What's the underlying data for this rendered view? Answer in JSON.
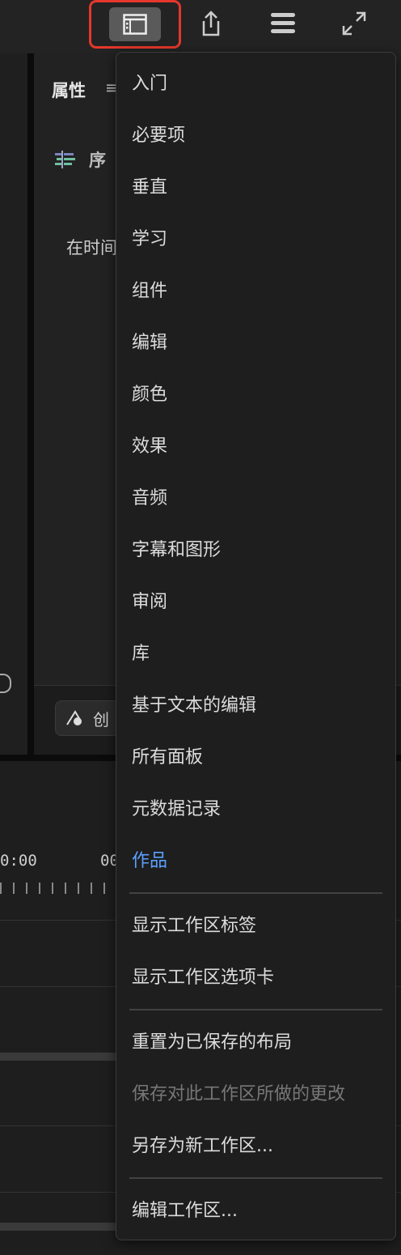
{
  "topbar": {
    "workspaces_icon": "workspace-panel-icon",
    "share_icon": "share-export-icon",
    "menu_icon": "stack-lines-icon",
    "fullscreen_icon": "expand-arrows-icon"
  },
  "properties": {
    "title": "属性",
    "seq_label": "序",
    "timeline_hint": "在时间",
    "create_label": "创"
  },
  "timeline": {
    "tc_left": "0:00",
    "tc_right": "00"
  },
  "menu": {
    "workspaces": [
      {
        "label": "入门"
      },
      {
        "label": "必要项"
      },
      {
        "label": "垂直"
      },
      {
        "label": "学习"
      },
      {
        "label": "组件"
      },
      {
        "label": "编辑"
      },
      {
        "label": "颜色"
      },
      {
        "label": "效果"
      },
      {
        "label": "音频"
      },
      {
        "label": "字幕和图形"
      },
      {
        "label": "审阅"
      },
      {
        "label": "库"
      },
      {
        "label": "基于文本的编辑"
      },
      {
        "label": "所有面板"
      },
      {
        "label": "元数据记录"
      },
      {
        "label": "作品"
      }
    ],
    "show_label_text": "显示工作区标签",
    "show_tabs_text": "显示工作区选项卡",
    "reset_text": "重置为已保存的布局",
    "save_changes_text": "保存对此工作区所做的更改",
    "save_as_text": "另存为新工作区...",
    "edit_text": "编辑工作区..."
  },
  "colors": {
    "accent": "#5aa0ff",
    "highlight_border": "#e5372b"
  }
}
